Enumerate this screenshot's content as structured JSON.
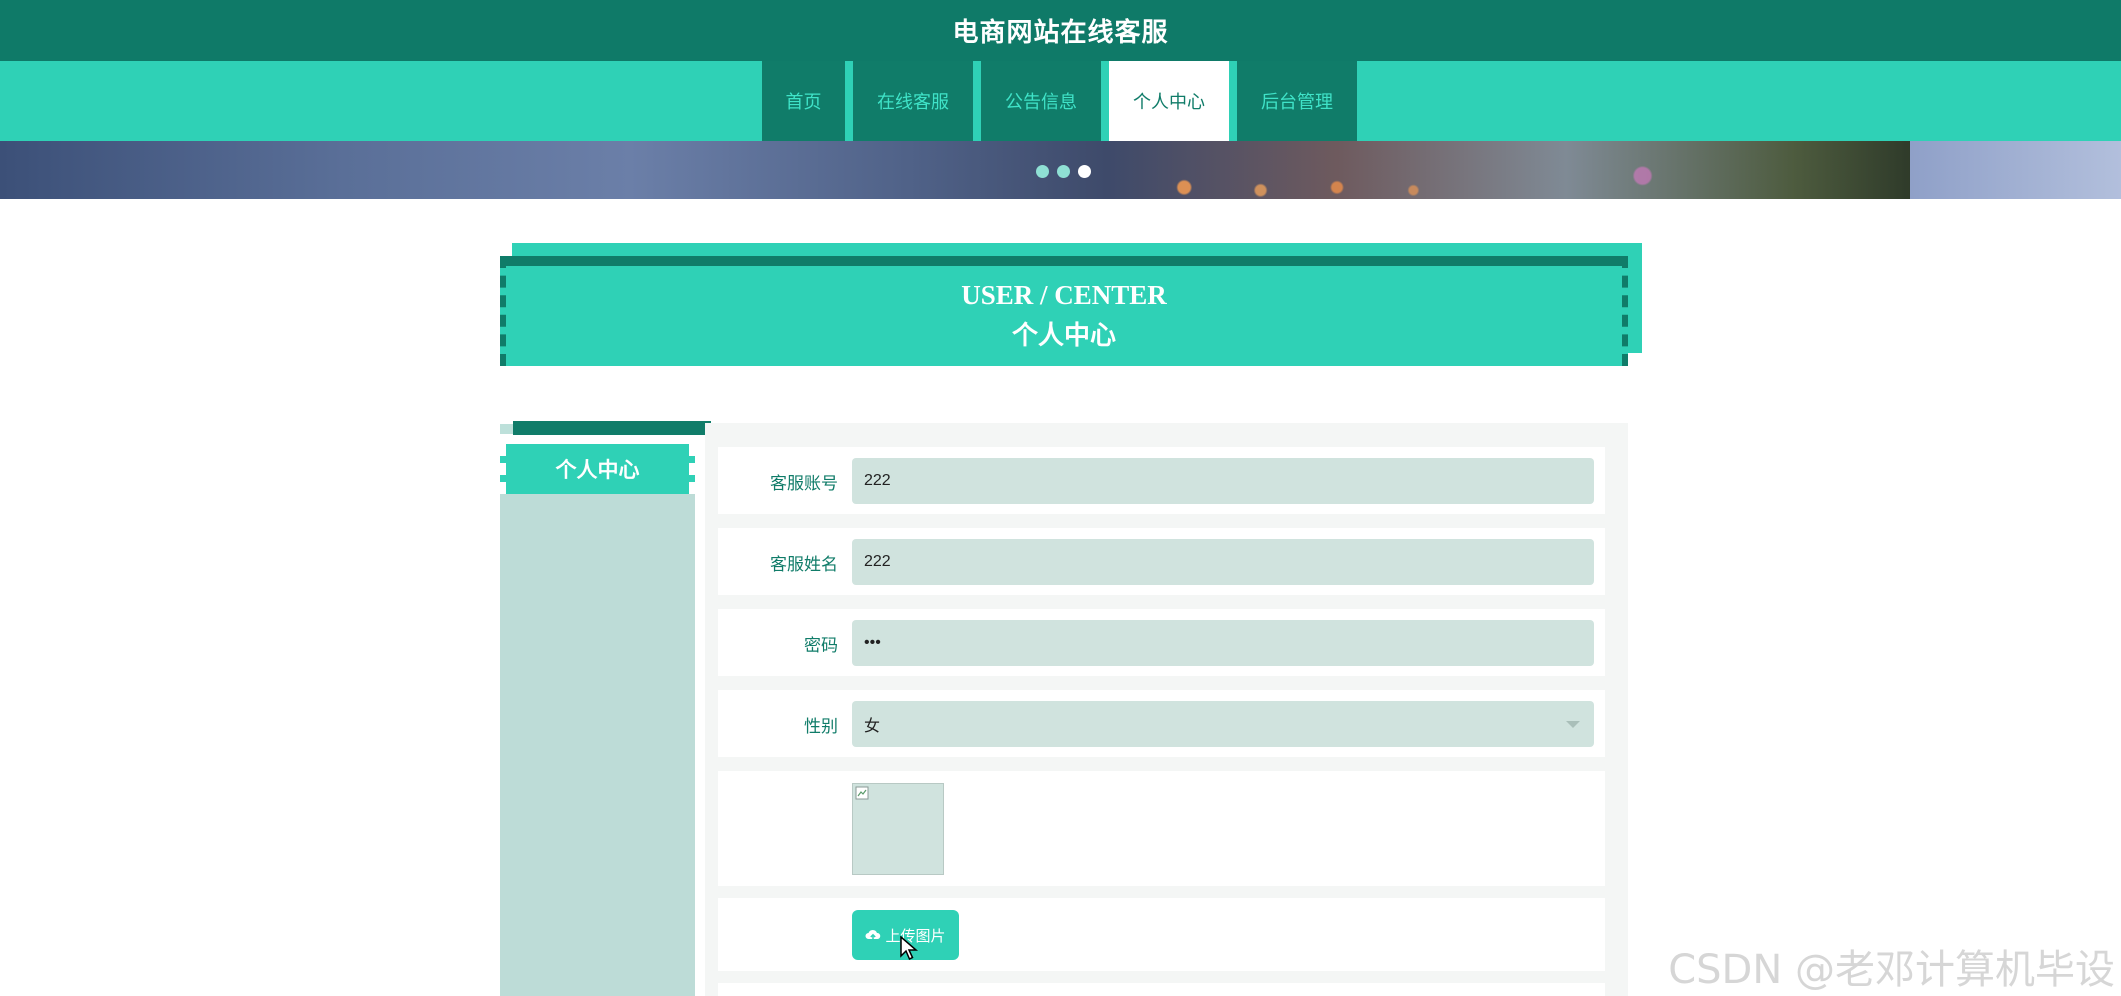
{
  "site": {
    "title": "电商网站在线客服"
  },
  "nav": {
    "items": [
      {
        "label": "首页"
      },
      {
        "label": "在线客服"
      },
      {
        "label": "公告信息"
      },
      {
        "label": "个人中心",
        "active": true
      },
      {
        "label": "后台管理"
      }
    ]
  },
  "banner": {
    "slide_count": 3,
    "active_index": 2
  },
  "section": {
    "title_en": "USER / CENTER",
    "title_cn": "个人中心"
  },
  "sidebar": {
    "items": [
      {
        "label": "个人中心"
      }
    ]
  },
  "form": {
    "account": {
      "label": "客服账号",
      "value": "222"
    },
    "name": {
      "label": "客服姓名",
      "value": "222"
    },
    "password": {
      "label": "密码",
      "value": "•••"
    },
    "gender": {
      "label": "性别",
      "value": "女"
    },
    "photo": {
      "label": ""
    },
    "upload": {
      "label": "上传图片"
    }
  },
  "watermark": "CSDN @老邓计算机毕设",
  "colors": {
    "header_dark": "#0f7a68",
    "accent": "#2fd1b6",
    "field_bg": "#d0e3de",
    "sidebar_bg": "#bddcd7"
  },
  "icons": {
    "upload": "cloud-upload-icon",
    "select": "chevron-down-icon",
    "cursor": "mouse-cursor-icon",
    "broken_image": "broken-image-icon"
  }
}
